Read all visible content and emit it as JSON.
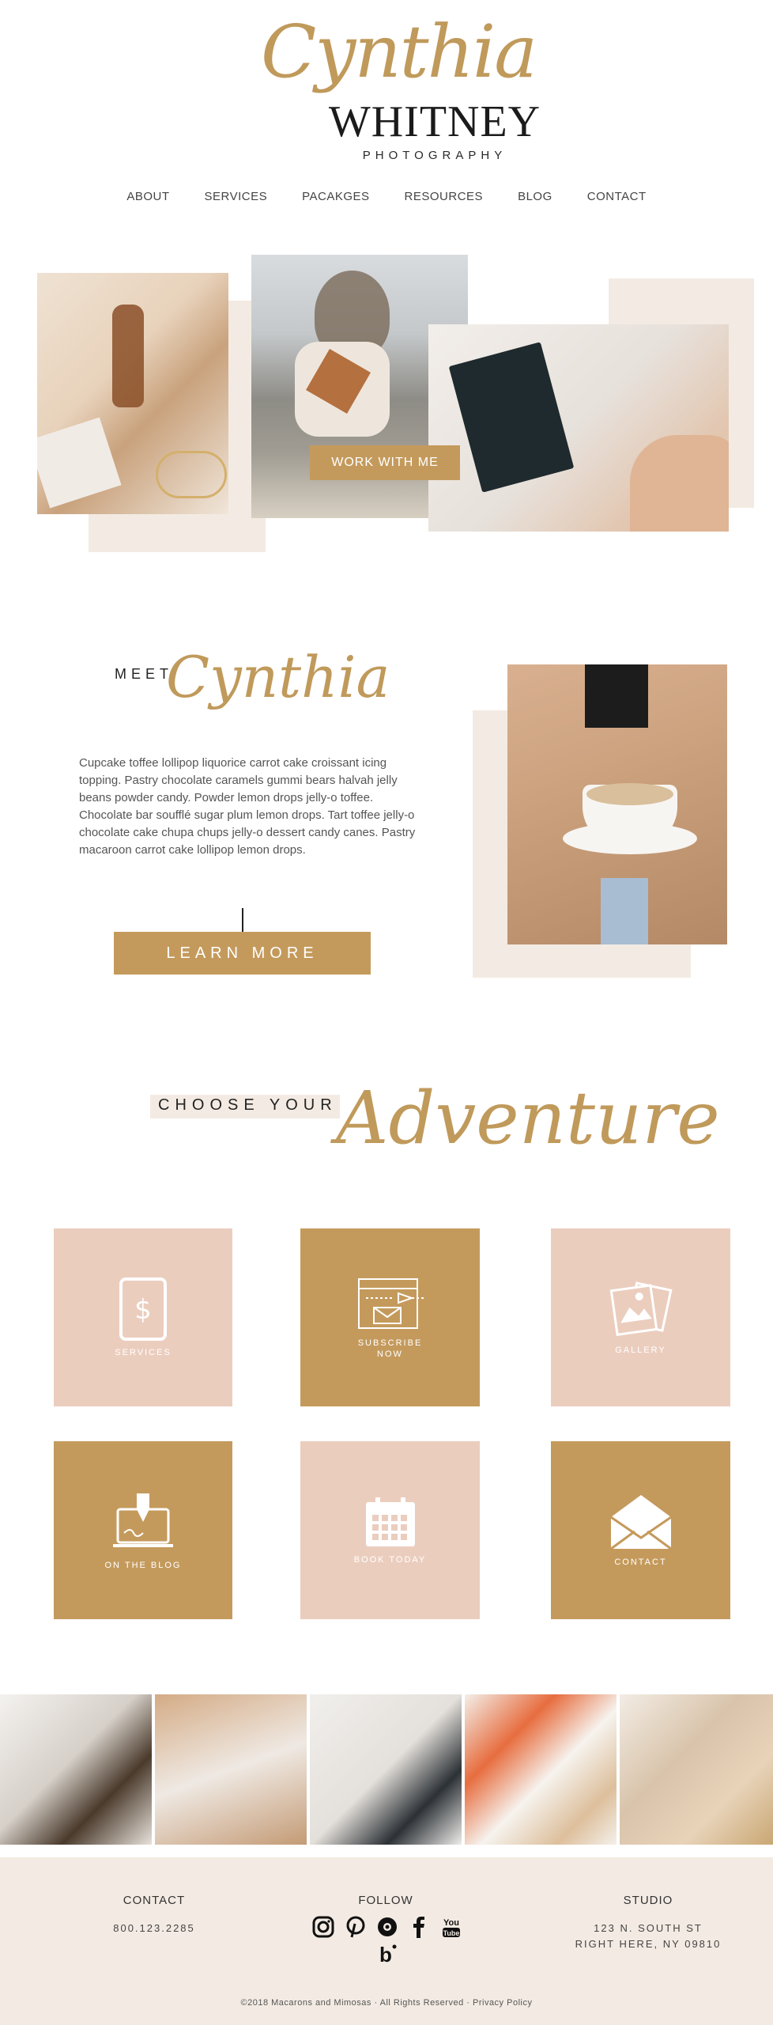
{
  "header": {
    "logo_script": "Cynthia",
    "logo_name": "WHITNEY",
    "logo_sub": "PHOTOGRAPHY"
  },
  "nav": [
    "ABOUT",
    "SERVICES",
    "PACAKGES",
    "RESOURCES",
    "BLOG",
    "CONTACT"
  ],
  "hero": {
    "cta": "WORK WITH ME"
  },
  "meet": {
    "label": "MEET",
    "script": "Cynthia",
    "bio": "Cupcake toffee lollipop liquorice carrot cake croissant icing topping. Pastry chocolate caramels gummi bears halvah jelly beans powder candy. Powder lemon drops jelly-o toffee. Chocolate bar soufflé sugar plum lemon drops. Tart toffee jelly-o chocolate cake chupa chups jelly-o dessert candy canes. Pastry macaroon carrot cake lollipop lemon drops.",
    "cta": "LEARN MORE"
  },
  "adventure": {
    "label": "CHOOSE YOUR",
    "script": "Adventure",
    "tiles": [
      {
        "label": "SERVICES",
        "icon": "tablet-dollar-icon",
        "style": "pink"
      },
      {
        "label": "SUBSCRIBE NOW",
        "icon": "newsletter-icon",
        "style": "gold"
      },
      {
        "label": "GALLERY",
        "icon": "photos-icon",
        "style": "pink"
      },
      {
        "label": "ON THE BLOG",
        "icon": "laptop-pen-icon",
        "style": "gold"
      },
      {
        "label": "BOOK TODAY",
        "icon": "calendar-icon",
        "style": "pink"
      },
      {
        "label": "CONTACT",
        "icon": "envelope-icon",
        "style": "gold"
      }
    ]
  },
  "footer": {
    "contact_head": "CONTACT",
    "phone": "800.123.2285",
    "follow_head": "FOLLOW",
    "social": [
      "instagram-icon",
      "pinterest-icon",
      "dribbble-icon",
      "facebook-icon",
      "youtube-icon",
      "bloglovin-icon"
    ],
    "studio_head": "STUDIO",
    "address_line1": "123 N. SOUTH ST",
    "address_line2": "RIGHT HERE, NY 09810",
    "copyright": "©2018 Macarons and Mimosas",
    "rights": "All Rights Reserved",
    "privacy": "Privacy Policy"
  },
  "colors": {
    "gold": "#c49a5c",
    "pink": "#ebcdbe",
    "beige": "#f3ebe3",
    "script": "#c09a5b"
  }
}
